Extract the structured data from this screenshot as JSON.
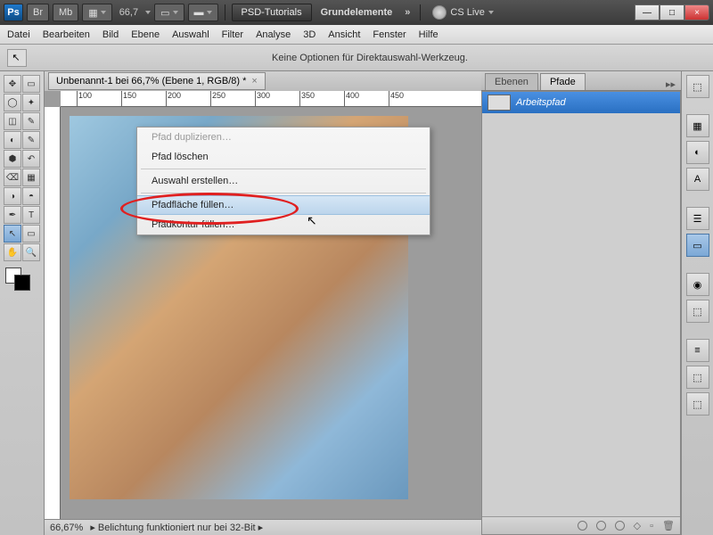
{
  "topbar": {
    "ps": "Ps",
    "br": "Br",
    "mb": "Mb",
    "zoom": "66,7",
    "psd_label": "PSD-Tutorials",
    "grund": "Grundelemente",
    "dbl": "»",
    "cs": "CS Live",
    "min": "—",
    "max": "□",
    "close": "×"
  },
  "menu": {
    "items": [
      "Datei",
      "Bearbeiten",
      "Bild",
      "Ebene",
      "Auswahl",
      "Filter",
      "Analyse",
      "3D",
      "Ansicht",
      "Fenster",
      "Hilfe"
    ]
  },
  "optbar": {
    "msg": "Keine Optionen für Direktauswahl-Werkzeug."
  },
  "doctab": {
    "title": "Unbenannt-1 bei 66,7% (Ebene 1, RGB/8) *",
    "close": "×"
  },
  "ruler": {
    "h": [
      "100",
      "150",
      "200",
      "250",
      "300",
      "350",
      "400",
      "450"
    ]
  },
  "status": {
    "zoom": "66,67%",
    "msg": "Belichtung funktioniert nur bei 32-Bit"
  },
  "panel": {
    "tab_ebenen": "Ebenen",
    "tab_pfade": "Pfade",
    "path_name": "Arbeitspfad",
    "ff": "▸▸"
  },
  "ctx": {
    "dup": "Pfad duplizieren…",
    "del": "Pfad löschen",
    "sel": "Auswahl erstellen…",
    "fill": "Pfadfläche füllen…",
    "stroke": "Pfadkontur füllen…"
  },
  "tools": {
    "l": [
      "⇱",
      "▭",
      "✥",
      "◌",
      "◫",
      "⟋",
      "◐",
      "✎",
      "◌",
      "⌫",
      "⚈",
      "⟆",
      "◢",
      "⎚",
      "△",
      "T",
      "↖",
      "▭",
      "✋",
      "🔍"
    ],
    "r": [
      "⬚",
      "▦",
      "◐",
      "A",
      "☰",
      "▭",
      "◉",
      "⬚",
      "≡",
      "⬚",
      "⬚"
    ]
  }
}
